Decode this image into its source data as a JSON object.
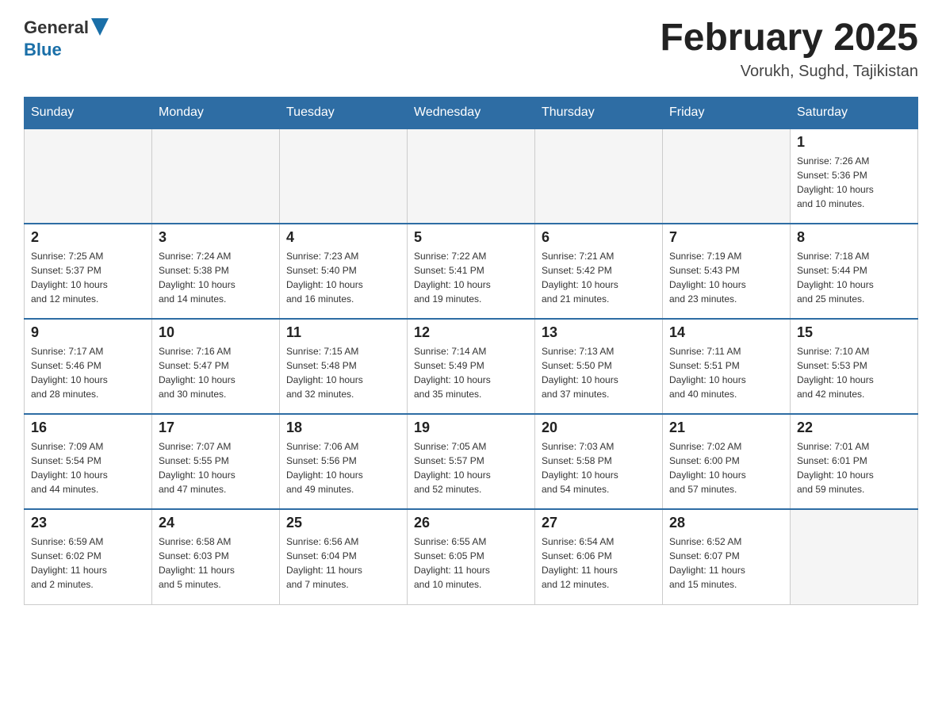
{
  "header": {
    "logo_general": "General",
    "logo_blue": "Blue",
    "month_title": "February 2025",
    "location": "Vorukh, Sughd, Tajikistan"
  },
  "weekdays": [
    "Sunday",
    "Monday",
    "Tuesday",
    "Wednesday",
    "Thursday",
    "Friday",
    "Saturday"
  ],
  "weeks": [
    [
      {
        "day": "",
        "info": ""
      },
      {
        "day": "",
        "info": ""
      },
      {
        "day": "",
        "info": ""
      },
      {
        "day": "",
        "info": ""
      },
      {
        "day": "",
        "info": ""
      },
      {
        "day": "",
        "info": ""
      },
      {
        "day": "1",
        "info": "Sunrise: 7:26 AM\nSunset: 5:36 PM\nDaylight: 10 hours\nand 10 minutes."
      }
    ],
    [
      {
        "day": "2",
        "info": "Sunrise: 7:25 AM\nSunset: 5:37 PM\nDaylight: 10 hours\nand 12 minutes."
      },
      {
        "day": "3",
        "info": "Sunrise: 7:24 AM\nSunset: 5:38 PM\nDaylight: 10 hours\nand 14 minutes."
      },
      {
        "day": "4",
        "info": "Sunrise: 7:23 AM\nSunset: 5:40 PM\nDaylight: 10 hours\nand 16 minutes."
      },
      {
        "day": "5",
        "info": "Sunrise: 7:22 AM\nSunset: 5:41 PM\nDaylight: 10 hours\nand 19 minutes."
      },
      {
        "day": "6",
        "info": "Sunrise: 7:21 AM\nSunset: 5:42 PM\nDaylight: 10 hours\nand 21 minutes."
      },
      {
        "day": "7",
        "info": "Sunrise: 7:19 AM\nSunset: 5:43 PM\nDaylight: 10 hours\nand 23 minutes."
      },
      {
        "day": "8",
        "info": "Sunrise: 7:18 AM\nSunset: 5:44 PM\nDaylight: 10 hours\nand 25 minutes."
      }
    ],
    [
      {
        "day": "9",
        "info": "Sunrise: 7:17 AM\nSunset: 5:46 PM\nDaylight: 10 hours\nand 28 minutes."
      },
      {
        "day": "10",
        "info": "Sunrise: 7:16 AM\nSunset: 5:47 PM\nDaylight: 10 hours\nand 30 minutes."
      },
      {
        "day": "11",
        "info": "Sunrise: 7:15 AM\nSunset: 5:48 PM\nDaylight: 10 hours\nand 32 minutes."
      },
      {
        "day": "12",
        "info": "Sunrise: 7:14 AM\nSunset: 5:49 PM\nDaylight: 10 hours\nand 35 minutes."
      },
      {
        "day": "13",
        "info": "Sunrise: 7:13 AM\nSunset: 5:50 PM\nDaylight: 10 hours\nand 37 minutes."
      },
      {
        "day": "14",
        "info": "Sunrise: 7:11 AM\nSunset: 5:51 PM\nDaylight: 10 hours\nand 40 minutes."
      },
      {
        "day": "15",
        "info": "Sunrise: 7:10 AM\nSunset: 5:53 PM\nDaylight: 10 hours\nand 42 minutes."
      }
    ],
    [
      {
        "day": "16",
        "info": "Sunrise: 7:09 AM\nSunset: 5:54 PM\nDaylight: 10 hours\nand 44 minutes."
      },
      {
        "day": "17",
        "info": "Sunrise: 7:07 AM\nSunset: 5:55 PM\nDaylight: 10 hours\nand 47 minutes."
      },
      {
        "day": "18",
        "info": "Sunrise: 7:06 AM\nSunset: 5:56 PM\nDaylight: 10 hours\nand 49 minutes."
      },
      {
        "day": "19",
        "info": "Sunrise: 7:05 AM\nSunset: 5:57 PM\nDaylight: 10 hours\nand 52 minutes."
      },
      {
        "day": "20",
        "info": "Sunrise: 7:03 AM\nSunset: 5:58 PM\nDaylight: 10 hours\nand 54 minutes."
      },
      {
        "day": "21",
        "info": "Sunrise: 7:02 AM\nSunset: 6:00 PM\nDaylight: 10 hours\nand 57 minutes."
      },
      {
        "day": "22",
        "info": "Sunrise: 7:01 AM\nSunset: 6:01 PM\nDaylight: 10 hours\nand 59 minutes."
      }
    ],
    [
      {
        "day": "23",
        "info": "Sunrise: 6:59 AM\nSunset: 6:02 PM\nDaylight: 11 hours\nand 2 minutes."
      },
      {
        "day": "24",
        "info": "Sunrise: 6:58 AM\nSunset: 6:03 PM\nDaylight: 11 hours\nand 5 minutes."
      },
      {
        "day": "25",
        "info": "Sunrise: 6:56 AM\nSunset: 6:04 PM\nDaylight: 11 hours\nand 7 minutes."
      },
      {
        "day": "26",
        "info": "Sunrise: 6:55 AM\nSunset: 6:05 PM\nDaylight: 11 hours\nand 10 minutes."
      },
      {
        "day": "27",
        "info": "Sunrise: 6:54 AM\nSunset: 6:06 PM\nDaylight: 11 hours\nand 12 minutes."
      },
      {
        "day": "28",
        "info": "Sunrise: 6:52 AM\nSunset: 6:07 PM\nDaylight: 11 hours\nand 15 minutes."
      },
      {
        "day": "",
        "info": ""
      }
    ]
  ]
}
